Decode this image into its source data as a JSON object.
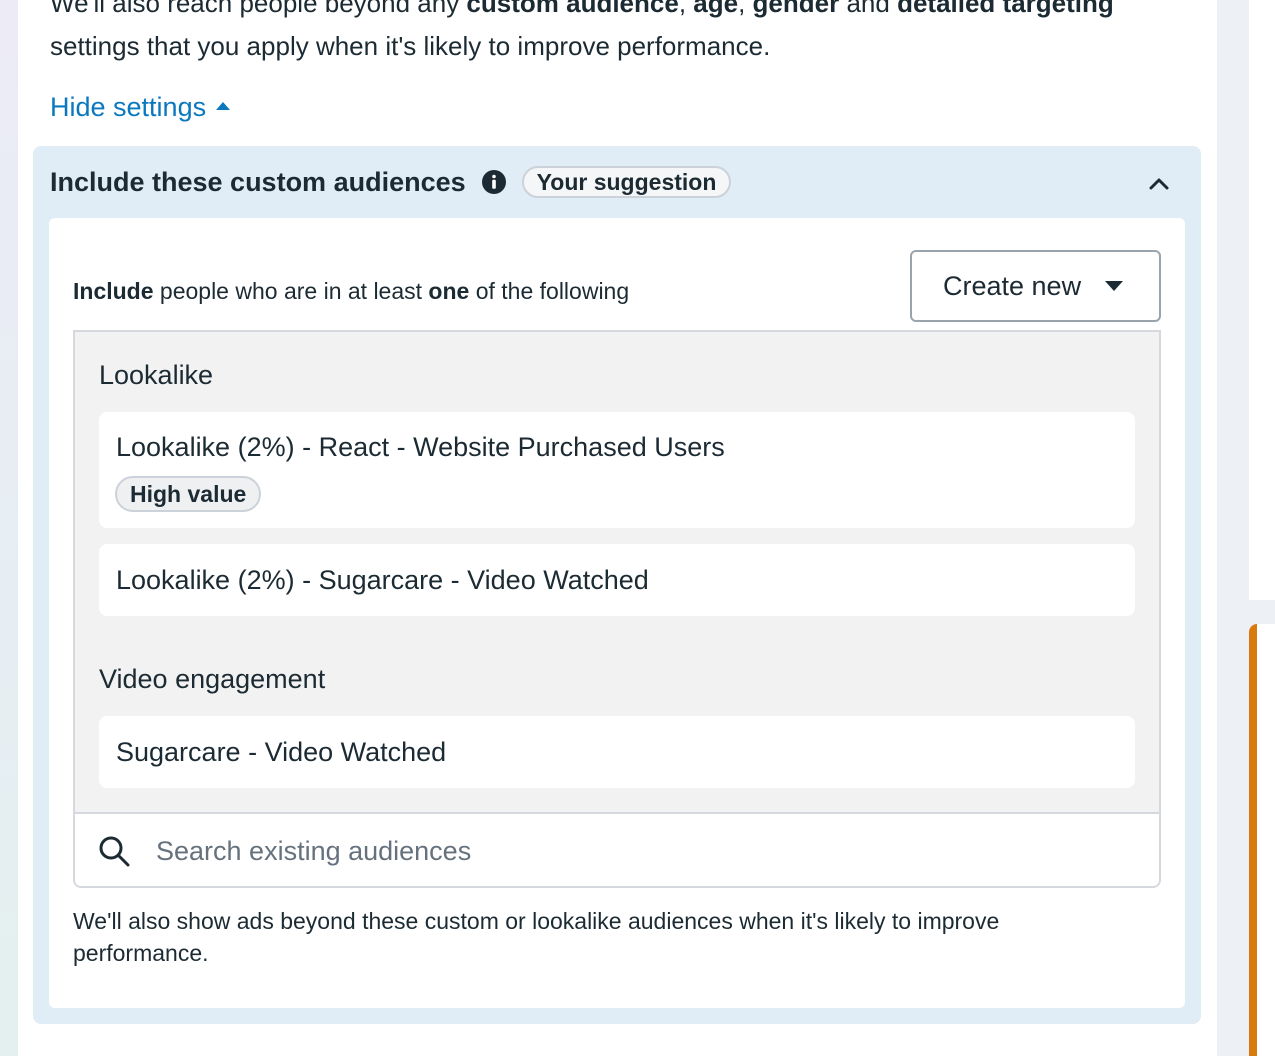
{
  "intro": {
    "prefix": "We'll also reach people beyond any ",
    "bold1": "custom audience",
    "sep1": ", ",
    "bold2": "age",
    "sep2": ", ",
    "bold3": "gender",
    "mid": " and ",
    "bold4": "detailed targeting",
    "suffix": " settings that you apply when it's likely to improve performance."
  },
  "hide_settings_label": "Hide settings",
  "section": {
    "title": "Include these custom audiences",
    "badge": "Your suggestion",
    "include_line": {
      "bold_include": "Include",
      "middle": " people who are in at least ",
      "bold_one": "one",
      "suffix": " of the following"
    },
    "create_new_label": "Create new",
    "groups": [
      {
        "label": "Lookalike",
        "items": [
          {
            "name": "Lookalike (2%) - React - Website Purchased Users",
            "badge": "High value"
          },
          {
            "name": "Lookalike (2%) - Sugarcare - Video Watched"
          }
        ]
      },
      {
        "label": "Video engagement",
        "items": [
          {
            "name": "Sugarcare - Video Watched"
          }
        ]
      }
    ],
    "search": {
      "placeholder": "Search existing audiences",
      "value": ""
    },
    "footnote": "We'll also show ads beyond these custom or lookalike audiences when it's likely to improve performance."
  },
  "colors": {
    "link": "#0a78be",
    "section_bg": "#e0edf6",
    "list_bg": "#f2f2f2",
    "accent_orange": "#d97a0c"
  },
  "icons": {
    "info": "info-icon",
    "collapse": "chevron-up-icon",
    "dropdown": "caret-down-icon",
    "search": "search-icon"
  }
}
